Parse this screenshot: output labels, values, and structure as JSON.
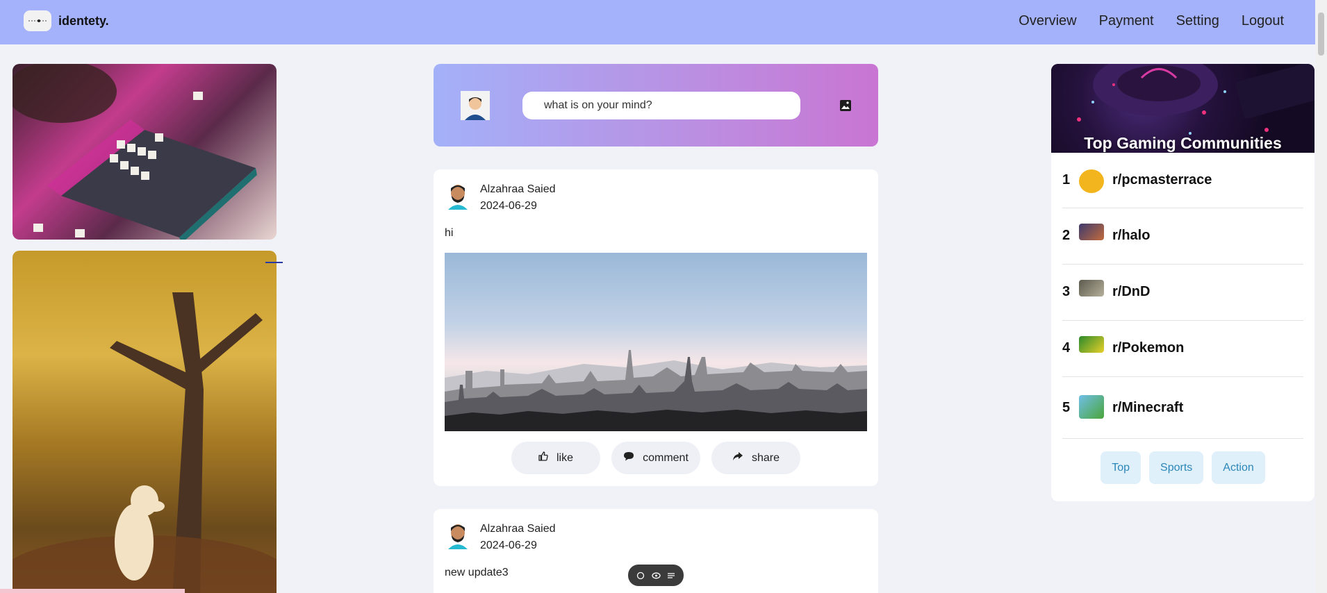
{
  "brand": {
    "name": "identety."
  },
  "nav": {
    "links": [
      "Overview",
      "Payment",
      "Setting",
      "Logout"
    ]
  },
  "composer": {
    "placeholder": "what is on your mind?"
  },
  "posts": [
    {
      "author": "Alzahraa Saied",
      "date": "2024-06-29",
      "text": "hi"
    },
    {
      "author": "Alzahraa Saied",
      "date": "2024-06-29",
      "text": "new update3"
    }
  ],
  "actions": {
    "like": "like",
    "comment": "comment",
    "share": "share"
  },
  "communities": {
    "title": "Top Gaming Communities",
    "items": [
      {
        "rank": "1",
        "name": "r/pcmasterrace",
        "icon": "pcmasterrace-icon"
      },
      {
        "rank": "2",
        "name": "r/halo",
        "icon": "halo-icon"
      },
      {
        "rank": "3",
        "name": "r/DnD",
        "icon": "dnd-icon"
      },
      {
        "rank": "4",
        "name": "r/Pokemon",
        "icon": "pokemon-icon"
      },
      {
        "rank": "5",
        "name": "r/Minecraft",
        "icon": "minecraft-icon"
      }
    ],
    "tags": [
      "Top",
      "Sports",
      "Action"
    ]
  },
  "colors": {
    "navbar": "#a4b1fb",
    "tag_bg": "#e0f0fb",
    "tag_text": "#2b87b9"
  }
}
